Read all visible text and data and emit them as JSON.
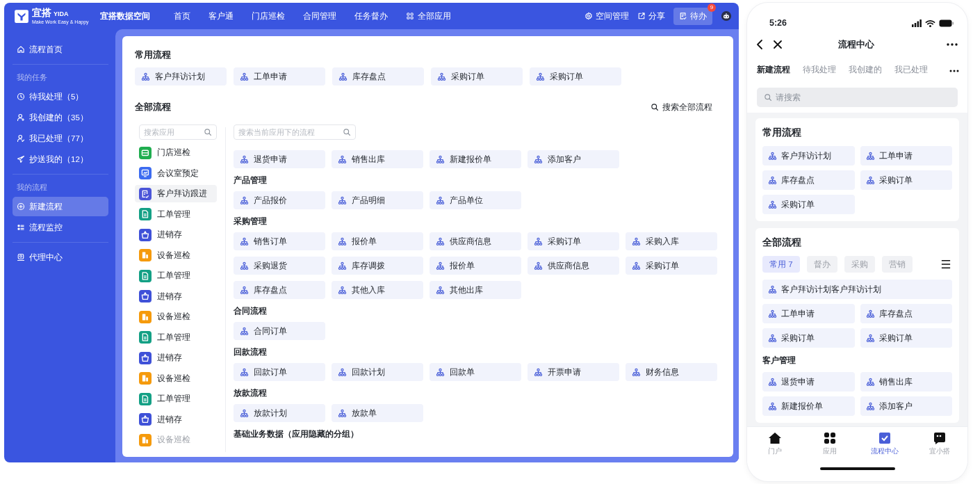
{
  "topbar": {
    "logo_text": "宜搭",
    "logo_latin": "YIDA",
    "logo_slogan": "Make Work Easy & Happy",
    "space_name": "宜搭数据空间",
    "nav": [
      {
        "label": "首页",
        "kind": "text"
      },
      {
        "label": "客户通",
        "kind": "text"
      },
      {
        "label": "门店巡检",
        "kind": "text"
      },
      {
        "label": "合同管理",
        "kind": "text"
      },
      {
        "label": "任务督办",
        "kind": "text"
      },
      {
        "label": "全部应用",
        "kind": "apps"
      }
    ],
    "actions": [
      {
        "label": "空间管理",
        "kind": "settings"
      },
      {
        "label": "分享",
        "kind": "share"
      }
    ],
    "todo": {
      "label": "待办",
      "badge": "9"
    }
  },
  "sidebar": {
    "groups": [
      {
        "items": [
          {
            "label": "流程首页",
            "kind": "home",
            "selected": false
          }
        ]
      },
      {
        "title": "我的任务",
        "items": [
          {
            "label": "待我处理（5）",
            "kind": "clock",
            "selected": false
          },
          {
            "label": "我创建的（35）",
            "kind": "user-plus",
            "selected": false
          },
          {
            "label": "我已处理（77）",
            "kind": "user-check",
            "selected": false
          },
          {
            "label": "抄送我的（12）",
            "kind": "send",
            "selected": false
          }
        ]
      },
      {
        "title": "我的流程",
        "items": [
          {
            "label": "新建流程",
            "kind": "plus",
            "selected": true
          },
          {
            "label": "流程监控",
            "kind": "list",
            "selected": false
          }
        ]
      },
      {
        "items": [
          {
            "label": "代理中心",
            "kind": "agent",
            "selected": false
          }
        ]
      }
    ]
  },
  "main": {
    "frequent": {
      "title": "常用流程",
      "items": [
        "客户拜访计划",
        "工单申请",
        "库存盘点",
        "采购订单",
        "采购订单"
      ]
    },
    "all": {
      "title": "全部流程",
      "search_all": "搜索全部流程",
      "app_search": {
        "placeholder": "搜索应用"
      },
      "apps": [
        {
          "name": "门店巡检",
          "kind": "store",
          "color": "#1fad4f",
          "selected": false,
          "faded": false
        },
        {
          "name": "会议室预定",
          "kind": "monitor",
          "color": "#3d6cf0",
          "selected": false,
          "faded": false
        },
        {
          "name": "客户拜访跟进",
          "kind": "edit",
          "color": "#4b55d8",
          "selected": true,
          "faded": false
        },
        {
          "name": "工单管理",
          "kind": "doc",
          "color": "#14a085",
          "selected": false,
          "faded": false
        },
        {
          "name": "进销存",
          "kind": "basket",
          "color": "#3f51d8",
          "selected": false,
          "faded": false
        },
        {
          "name": "设备巡检",
          "kind": "building",
          "color": "#f59a0c",
          "selected": false,
          "faded": false
        },
        {
          "name": "工单管理",
          "kind": "doc",
          "color": "#14a085",
          "selected": false,
          "faded": false
        },
        {
          "name": "进销存",
          "kind": "basket",
          "color": "#3f51d8",
          "selected": false,
          "faded": false
        },
        {
          "name": "设备巡检",
          "kind": "building",
          "color": "#f59a0c",
          "selected": false,
          "faded": false
        },
        {
          "name": "工单管理",
          "kind": "doc",
          "color": "#14a085",
          "selected": false,
          "faded": false
        },
        {
          "name": "进销存",
          "kind": "basket",
          "color": "#3f51d8",
          "selected": false,
          "faded": false
        },
        {
          "name": "设备巡检",
          "kind": "building",
          "color": "#f59a0c",
          "selected": false,
          "faded": false
        },
        {
          "name": "工单管理",
          "kind": "doc",
          "color": "#14a085",
          "selected": false,
          "faded": false
        },
        {
          "name": "进销存",
          "kind": "basket",
          "color": "#3f51d8",
          "selected": false,
          "faded": false
        },
        {
          "name": "设备巡检",
          "kind": "building",
          "color": "#f59a0c",
          "selected": false,
          "faded": true
        }
      ],
      "flow_search": {
        "placeholder": "搜索当前应用下的流程"
      },
      "groups": [
        {
          "items": [
            "退货申请",
            "销售出库",
            "新建报价单",
            "添加客户"
          ]
        },
        {
          "title": "产品管理",
          "items": [
            "产品报价",
            "产品明细",
            "产品单位"
          ]
        },
        {
          "title": "采购管理",
          "items": [
            "销售订单",
            "报价单",
            "供应商信息",
            "采购订单",
            "采购入库",
            "采购退货",
            "库存调拨",
            "报价单",
            "供应商信息",
            "采购订单",
            "库存盘点",
            "其他入库",
            "其他出库"
          ]
        },
        {
          "title": "合同流程",
          "items": [
            "合同订单"
          ]
        },
        {
          "title": "回款流程",
          "items": [
            "回款订单",
            "回款计划",
            "回款单",
            "开票申请",
            "财务信息"
          ]
        },
        {
          "title": "放款流程",
          "items": [
            "放款计划",
            "放款单"
          ]
        },
        {
          "title": "基础业务数据（应用隐藏的分组）"
        }
      ]
    }
  },
  "phone": {
    "time": "5:26",
    "title": "流程中心",
    "tabs": [
      {
        "label": "新建流程",
        "selected": true
      },
      {
        "label": "待我处理",
        "selected": false
      },
      {
        "label": "我创建的",
        "selected": false
      },
      {
        "label": "我已处理",
        "selected": false
      }
    ],
    "search": {
      "placeholder": "请搜索"
    },
    "frequent": {
      "title": "常用流程",
      "items": [
        "客户拜访计划",
        "工单申请",
        "库存盘点",
        "采购订单",
        "采购订单"
      ]
    },
    "all": {
      "title": "全部流程",
      "filters": [
        {
          "label": "常用 7",
          "selected": true
        },
        {
          "label": "督办",
          "selected": false
        },
        {
          "label": "采购",
          "selected": false
        },
        {
          "label": "营销",
          "selected": false
        }
      ],
      "groups": [
        {
          "items": [
            "客户拜访计划客户拜访计划",
            "工单申请",
            "库存盘点",
            "采购订单",
            "采购订单"
          ]
        },
        {
          "title": "客户管理",
          "items": [
            "退货申请",
            "销售出库",
            "新建报价单",
            "添加客户"
          ]
        }
      ]
    },
    "tab_bar": [
      {
        "label": "门户",
        "kind": "home",
        "selected": false
      },
      {
        "label": "应用",
        "kind": "apps",
        "selected": false
      },
      {
        "label": "流程中心",
        "kind": "check",
        "selected": true
      },
      {
        "label": "宜小搭",
        "kind": "assistant",
        "selected": false
      }
    ]
  }
}
